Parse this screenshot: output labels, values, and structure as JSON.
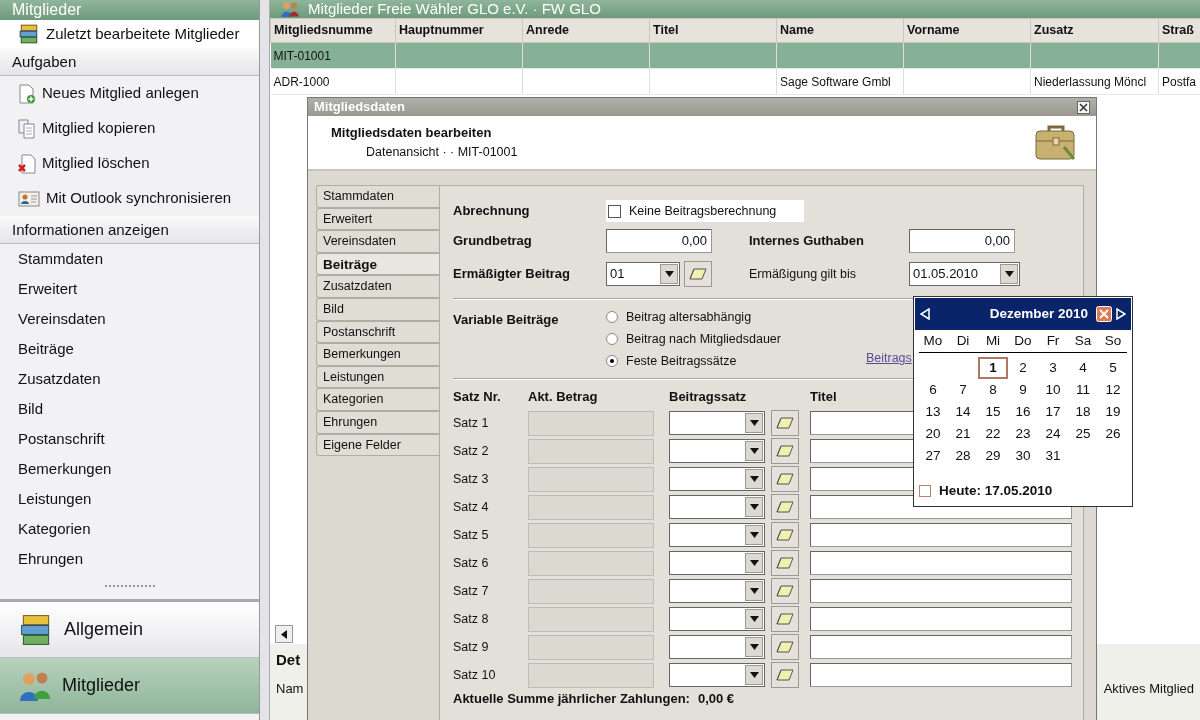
{
  "sidebar": {
    "title": "Mitglieder",
    "recent": {
      "label": "Zuletzt bearbeitete Mitglieder"
    },
    "sections": [
      {
        "title": "Aufgaben",
        "items": [
          {
            "label": "Neues Mitglied anlegen",
            "kind": "new"
          },
          {
            "label": "Mitglied kopieren",
            "kind": "copy"
          },
          {
            "label": "Mitglied löschen",
            "kind": "delete"
          },
          {
            "label": "Mit Outlook synchronisieren",
            "kind": "sync"
          }
        ]
      },
      {
        "title": "Informationen anzeigen",
        "items": [
          {
            "label": "Stammdaten"
          },
          {
            "label": "Erweitert"
          },
          {
            "label": "Vereinsdaten"
          },
          {
            "label": "Beiträge"
          },
          {
            "label": "Zusatzdaten"
          },
          {
            "label": "Bild"
          },
          {
            "label": "Postanschrift"
          },
          {
            "label": "Bemerkungen"
          },
          {
            "label": "Leistungen"
          },
          {
            "label": "Kategorien"
          },
          {
            "label": "Ehrungen"
          }
        ]
      }
    ],
    "nav": [
      {
        "label": "Allgemein",
        "kind": "books",
        "selected": false
      },
      {
        "label": "Mitglieder",
        "kind": "people",
        "selected": true
      }
    ]
  },
  "main": {
    "title": "Mitglieder Freie Wähler GLO e.V. · FW GLO",
    "table": {
      "columns": [
        "Mitgliedsnumme",
        "Hauptnummer",
        "Anrede",
        "Titel",
        "Name",
        "Vorname",
        "Zusatz",
        "Straß"
      ],
      "rows": [
        {
          "selected": true,
          "cells": [
            "MIT-01001",
            null,
            null,
            null,
            null,
            null,
            null,
            null
          ]
        },
        {
          "selected": false,
          "cells": [
            "ADR-1000",
            null,
            null,
            null,
            "Sage Software Gmbl",
            null,
            "Niederlassung Möncl",
            "Postfa"
          ]
        }
      ]
    },
    "detail": {
      "title": "Det",
      "field_label": "Nam",
      "status": "Aktives Mitglied"
    }
  },
  "dialog": {
    "title": "Mitgliedsdaten",
    "heading": "Mitgliedsdaten bearbeiten",
    "subheading": "Datenansicht ·  · MIT-01001",
    "tabs": [
      {
        "label": "Stammdaten",
        "selected": false
      },
      {
        "label": "Erweitert",
        "selected": false
      },
      {
        "label": "Vereinsdaten",
        "selected": false
      },
      {
        "label": "Beiträge",
        "selected": true
      },
      {
        "label": "Zusatzdaten",
        "selected": false
      },
      {
        "label": "Bild",
        "selected": false
      },
      {
        "label": "Postanschrift",
        "selected": false
      },
      {
        "label": "Bemerkungen",
        "selected": false
      },
      {
        "label": "Leistungen",
        "selected": false
      },
      {
        "label": "Kategorien",
        "selected": false
      },
      {
        "label": "Ehrungen",
        "selected": false
      },
      {
        "label": "Eigene Felder",
        "selected": false
      }
    ],
    "billing": {
      "label": "Abrechnung",
      "checkbox": {
        "label": "Keine Beitragsberechnung",
        "checked": false
      }
    },
    "base_amount": {
      "label": "Grundbetrag",
      "value": "0,00"
    },
    "credit": {
      "label": "Internes Guthaben",
      "value": "0,00"
    },
    "reduced": {
      "label": "Ermäßigter Beitrag",
      "value": "01"
    },
    "reduced_until": {
      "label": "Ermäßigung gilt bis",
      "value": "01.05.2010"
    },
    "variable": {
      "label": "Variable Beiträge",
      "link": "Beitrags",
      "options": [
        {
          "label": "Beitrag altersabhängig",
          "selected": false
        },
        {
          "label": "Beitrag nach Mitgliedsdauer",
          "selected": false
        },
        {
          "label": "Feste Beitragssätze",
          "selected": true
        }
      ]
    },
    "rates": {
      "columns": [
        "Satz Nr.",
        "Akt. Betrag",
        "Beitragssatz",
        "Titel"
      ],
      "rows": [
        {
          "label": "Satz 1"
        },
        {
          "label": "Satz 2"
        },
        {
          "label": "Satz 3"
        },
        {
          "label": "Satz 4"
        },
        {
          "label": "Satz 5"
        },
        {
          "label": "Satz 6"
        },
        {
          "label": "Satz 7"
        },
        {
          "label": "Satz 8"
        },
        {
          "label": "Satz 9"
        },
        {
          "label": "Satz 10"
        }
      ]
    },
    "total": {
      "label": "Aktuelle Summe jährlicher Zahlungen:",
      "value": "0,00 €"
    },
    "calendar": {
      "month": "Dezember 2010",
      "weekdays": [
        "Mo",
        "Di",
        "Mi",
        "Do",
        "Fr",
        "Sa",
        "So"
      ],
      "weeks": [
        [
          {
            "kind": "blank"
          },
          {
            "kind": "blank"
          },
          {
            "kind": "day",
            "day": "1",
            "selected": true
          },
          {
            "kind": "day",
            "day": "2",
            "selected": false
          },
          {
            "kind": "day",
            "day": "3",
            "selected": false
          },
          {
            "kind": "day",
            "day": "4",
            "selected": false
          },
          {
            "kind": "day",
            "day": "5",
            "selected": false
          }
        ],
        [
          {
            "kind": "day",
            "day": "6",
            "selected": false
          },
          {
            "kind": "day",
            "day": "7",
            "selected": false
          },
          {
            "kind": "day",
            "day": "8",
            "selected": false
          },
          {
            "kind": "day",
            "day": "9",
            "selected": false
          },
          {
            "kind": "day",
            "day": "10",
            "selected": false
          },
          {
            "kind": "day",
            "day": "11",
            "selected": false
          },
          {
            "kind": "day",
            "day": "12",
            "selected": false
          }
        ],
        [
          {
            "kind": "day",
            "day": "13",
            "selected": false
          },
          {
            "kind": "day",
            "day": "14",
            "selected": false
          },
          {
            "kind": "day",
            "day": "15",
            "selected": false
          },
          {
            "kind": "day",
            "day": "16",
            "selected": false
          },
          {
            "kind": "day",
            "day": "17",
            "selected": false
          },
          {
            "kind": "day",
            "day": "18",
            "selected": false
          },
          {
            "kind": "day",
            "day": "19",
            "selected": false
          }
        ],
        [
          {
            "kind": "day",
            "day": "20",
            "selected": false
          },
          {
            "kind": "day",
            "day": "21",
            "selected": false
          },
          {
            "kind": "day",
            "day": "22",
            "selected": false
          },
          {
            "kind": "day",
            "day": "23",
            "selected": false
          },
          {
            "kind": "day",
            "day": "24",
            "selected": false
          },
          {
            "kind": "day",
            "day": "25",
            "selected": false
          },
          {
            "kind": "day",
            "day": "26",
            "selected": false
          }
        ],
        [
          {
            "kind": "day",
            "day": "27",
            "selected": false
          },
          {
            "kind": "day",
            "day": "28",
            "selected": false
          },
          {
            "kind": "day",
            "day": "29",
            "selected": false
          },
          {
            "kind": "day",
            "day": "30",
            "selected": false
          },
          {
            "kind": "day",
            "day": "31",
            "selected": false
          },
          {
            "kind": "blank"
          },
          {
            "kind": "blank"
          }
        ]
      ],
      "today": {
        "label": "Heute: 17.05.2010",
        "checked": false
      }
    }
  }
}
